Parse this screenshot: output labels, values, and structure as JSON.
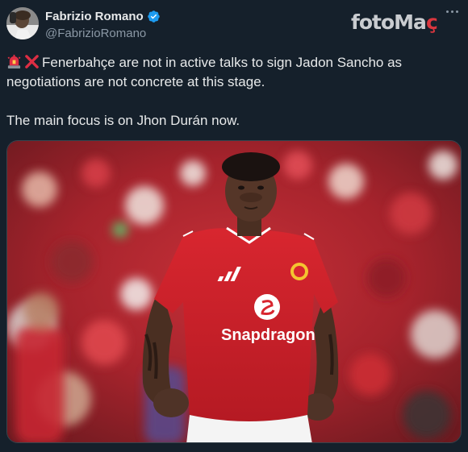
{
  "author": {
    "name": "Fabrizio Romano",
    "handle": "@FabrizioRomano",
    "verified": true
  },
  "watermark": {
    "part1": "fotoMa",
    "part2": "ç"
  },
  "tweet": {
    "emoji1": "siren-icon",
    "emoji2": "cross-mark-icon",
    "line1": "Fenerbahçe are not in active talks to sign Jadon Sancho as negotiations are not concrete at this stage.",
    "line2": "The main focus is on Jhon Durán now."
  },
  "media": {
    "jersey_sponsor": "Snapdragon",
    "colors": {
      "shirt": "#cf1f2a",
      "background": "#b8202a",
      "skin": "#5a3a2a"
    }
  },
  "colors": {
    "background": "#15202b",
    "text": "#e7e9ea",
    "muted": "#8b98a5",
    "verified": "#1d9bf0",
    "watermark_accent": "#d9363e"
  }
}
